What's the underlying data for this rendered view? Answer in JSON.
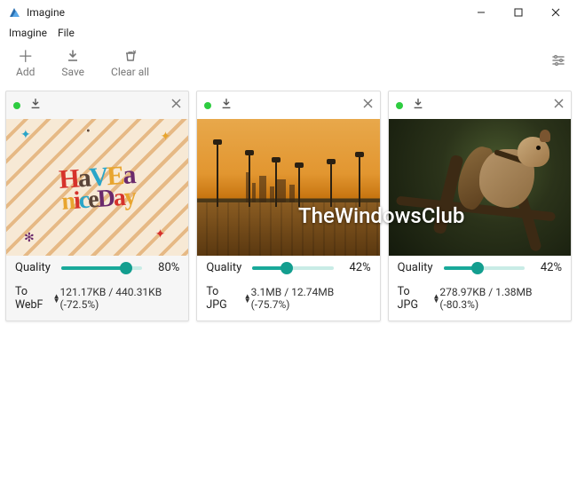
{
  "window": {
    "title": "Imagine"
  },
  "menu": {
    "items": [
      "Imagine",
      "File"
    ]
  },
  "toolbar": {
    "add": "Add",
    "save": "Save",
    "clear": "Clear all"
  },
  "watermark": {
    "text": "TheWindowsClub"
  },
  "quality_label": "Quality",
  "cards": [
    {
      "format_label": "To WebF",
      "quality_pct": 80,
      "stats": "121.17KB / 440.31KB (-72.5%)"
    },
    {
      "format_label": "To JPG",
      "quality_pct": 42,
      "stats": "3.1MB / 12.74MB (-75.7%)"
    },
    {
      "format_label": "To JPG",
      "quality_pct": 42,
      "stats": "278.97KB / 1.38MB (-80.3%)"
    }
  ]
}
